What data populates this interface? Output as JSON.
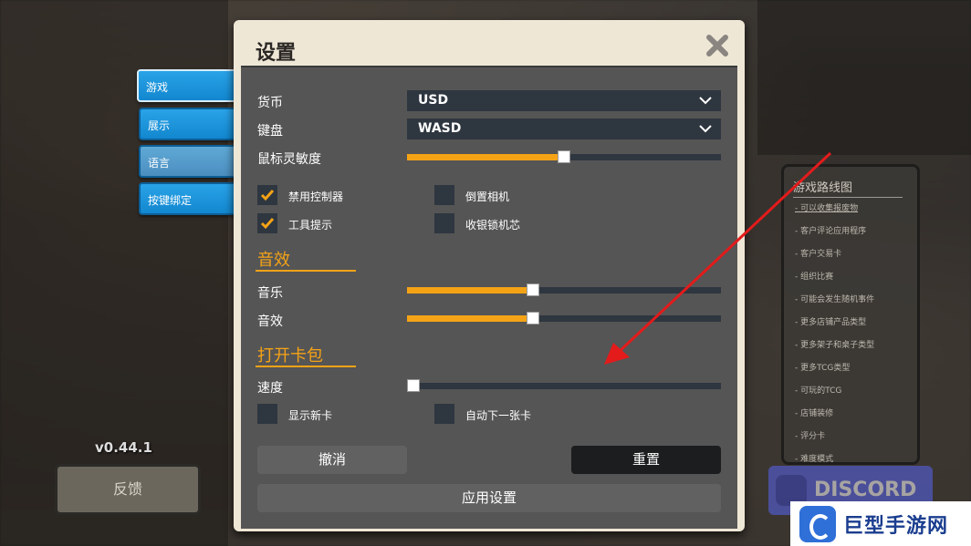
{
  "version": "v0.44.1",
  "feedback_label": "反馈",
  "side_tabs": [
    "游戏",
    "展示",
    "语言",
    "按键绑定"
  ],
  "roadmap": {
    "title": "游戏路线图",
    "items": [
      "可以收集报废物",
      "客户评论应用程序",
      "客户交易卡",
      "组织比赛",
      "可能会发生随机事件",
      "更多店铺产品类型",
      "更多架子和桌子类型",
      "更多TCG类型",
      "可玩的TCG",
      "店铺装修",
      "评分卡",
      "难度模式"
    ]
  },
  "discord_label": "DISCORD",
  "watermark_label": "巨型手游网",
  "dialog": {
    "title": "设置",
    "currency": {
      "label": "货币",
      "value": "USD"
    },
    "keyboard": {
      "label": "键盘",
      "value": "WASD"
    },
    "mouse_sensitivity": {
      "label": "鼠标灵敏度",
      "level": 0.5
    },
    "checkboxes": [
      {
        "label": "禁用控制器",
        "checked": true
      },
      {
        "label": "倒置相机",
        "checked": false
      },
      {
        "label": "工具提示",
        "checked": true
      },
      {
        "label": "收银锁机芯",
        "checked": false
      }
    ],
    "sound_section": "音效",
    "music": {
      "label": "音乐",
      "level": 0.4
    },
    "sfx": {
      "label": "音效",
      "level": 0.4
    },
    "pack_section": "打开卡包",
    "speed": {
      "label": "速度",
      "level": 0.0
    },
    "pack_checkboxes": [
      {
        "label": "显示新卡",
        "checked": false
      },
      {
        "label": "自动下一张卡",
        "checked": false
      }
    ],
    "cancel_label": "撤消",
    "reset_label": "重置",
    "apply_label": "应用设置"
  },
  "colors": {
    "accent": "#f5a316",
    "tab_blue": "#1a94dc",
    "panel": "#555555",
    "field": "#2e3640"
  }
}
